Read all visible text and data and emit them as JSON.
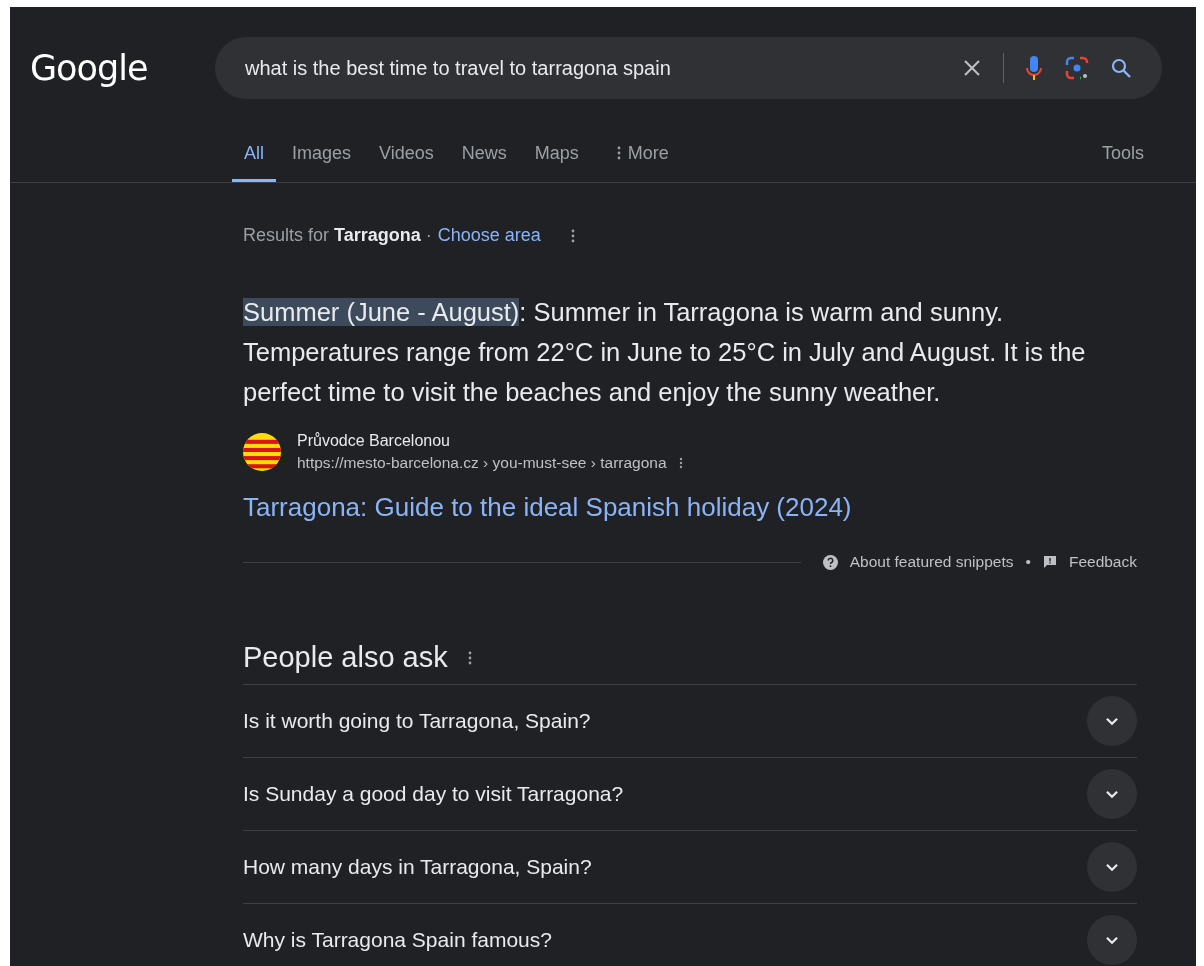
{
  "logo": "Google",
  "search": {
    "value": "what is the best time to travel to tarragona spain"
  },
  "tabs": [
    {
      "label": "All",
      "selected": true
    },
    {
      "label": "Images",
      "selected": false
    },
    {
      "label": "Videos",
      "selected": false
    },
    {
      "label": "News",
      "selected": false
    },
    {
      "label": "Maps",
      "selected": false
    }
  ],
  "more_label": "More",
  "tools_label": "Tools",
  "location": {
    "prefix": "Results for",
    "place": "Tarragona",
    "separator": "·",
    "link": "Choose area"
  },
  "snippet": {
    "highlight": "Summer (June - August)",
    "text": ": Summer in Tarragona is warm and sunny. Temperatures range from 22°C in June to 25°C in July and August. It is the perfect time to visit the beaches and enjoy the sunny weather."
  },
  "source": {
    "site": "Průvodce Barcelonou",
    "url": "https://mesto-barcelona.cz › you-must-see › tarragona",
    "title": "Tarragona: Guide to the ideal Spanish holiday (2024)"
  },
  "footer": {
    "about": "About featured snippets",
    "separator": "•",
    "feedback": "Feedback"
  },
  "people_also_ask": {
    "title": "People also ask",
    "questions": [
      {
        "text": "Is it worth going to Tarragona, Spain?",
        "expanded": false
      },
      {
        "text": "Is Sunday a good day to visit Tarragona?",
        "expanded": false
      },
      {
        "text": "How many days in Tarragona, Spain?",
        "expanded": false
      },
      {
        "text": "Why is Tarragona Spain famous?",
        "expanded": false
      }
    ]
  }
}
